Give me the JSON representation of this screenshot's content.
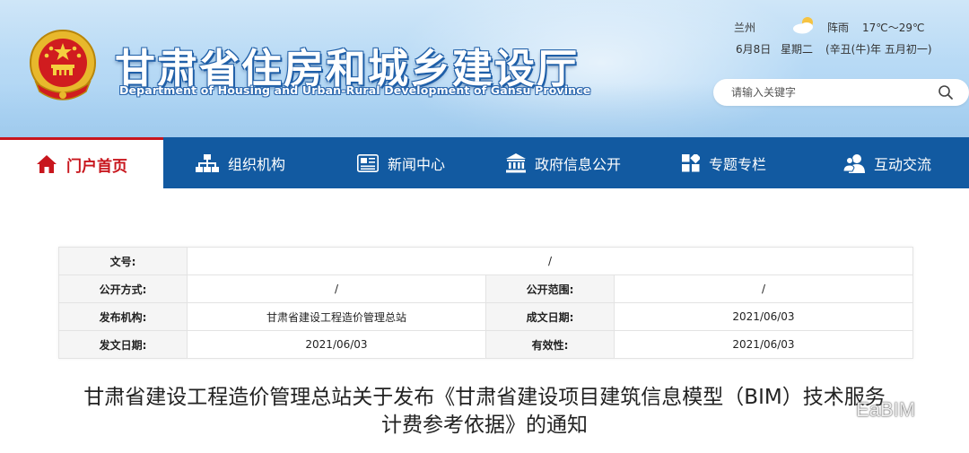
{
  "header": {
    "title": "甘肃省住房和城乡建设厅",
    "subtitle": "Department of Housing and Urban-Rural Development of Gansu Province",
    "weather": {
      "city": "兰州",
      "condition": "阵雨",
      "temp": "17℃～29℃",
      "icon": "cloud-sun-icon"
    },
    "date": {
      "day": "6月8日",
      "weekday": "星期二",
      "lunar": "(辛丑(牛)年 五月初一)"
    },
    "search": {
      "placeholder": "请输入关键字"
    }
  },
  "nav": {
    "items": [
      {
        "label": "门户首页",
        "icon": "home-icon"
      },
      {
        "label": "组织机构",
        "icon": "org-chart-icon"
      },
      {
        "label": "新闻中心",
        "icon": "newspaper-icon"
      },
      {
        "label": "政府信息公开",
        "icon": "government-building-icon"
      },
      {
        "label": "专题专栏",
        "icon": "grid-icon"
      },
      {
        "label": "互动交流",
        "icon": "users-icon"
      }
    ]
  },
  "info": {
    "doc_no_label": "文号:",
    "doc_no_value": "/",
    "open_method_label": "公开方式:",
    "open_method_value": "/",
    "open_scope_label": "公开范围:",
    "open_scope_value": "/",
    "issuer_label": "发布机构:",
    "issuer_value": "甘肃省建设工程造价管理总站",
    "created_label": "成文日期:",
    "created_value": "2021/06/03",
    "issued_label": "发文日期:",
    "issued_value": "2021/06/03",
    "validity_label": "有效性:",
    "validity_value": "2021/06/03"
  },
  "article": {
    "title_line1": "甘肃省建设工程造价管理总站关于发布《甘肃省建设项目建筑信息模型（BIM）技术服务",
    "title_line2": "计费参考依据》的通知"
  },
  "watermark": {
    "text": "EaBIM"
  },
  "colors": {
    "nav_bg": "#125aa1",
    "accent_red": "#c8161d",
    "header_sky": "#b8daf5"
  }
}
